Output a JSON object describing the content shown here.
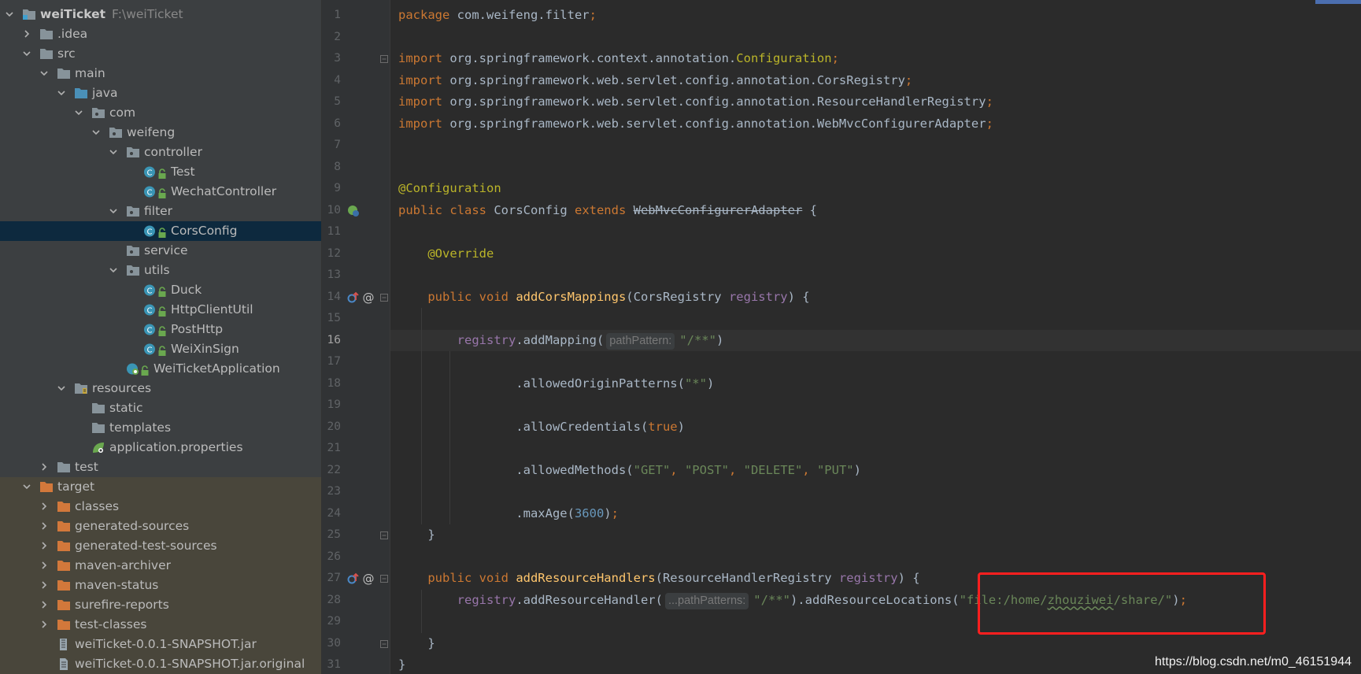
{
  "project": {
    "name": "weiTicket",
    "path": "F:\\weiTicket",
    "tree": [
      {
        "label": "weiTicket",
        "depth": 0,
        "chevron": "down",
        "icon": "module-icon",
        "bold": true,
        "hint": "F:\\weiTicket"
      },
      {
        "label": ".idea",
        "depth": 1,
        "chevron": "right",
        "icon": "folder-icon"
      },
      {
        "label": "src",
        "depth": 1,
        "chevron": "down",
        "icon": "folder-icon"
      },
      {
        "label": "main",
        "depth": 2,
        "chevron": "down",
        "icon": "folder-icon"
      },
      {
        "label": "java",
        "depth": 3,
        "chevron": "down",
        "icon": "source-folder-icon"
      },
      {
        "label": "com",
        "depth": 4,
        "chevron": "down",
        "icon": "package-icon"
      },
      {
        "label": "weifeng",
        "depth": 5,
        "chevron": "down",
        "icon": "package-icon"
      },
      {
        "label": "controller",
        "depth": 6,
        "chevron": "down",
        "icon": "package-icon"
      },
      {
        "label": "Test",
        "depth": 7,
        "chevron": "none",
        "icon": "class-icon"
      },
      {
        "label": "WechatController",
        "depth": 7,
        "chevron": "none",
        "icon": "class-icon"
      },
      {
        "label": "filter",
        "depth": 6,
        "chevron": "down",
        "icon": "package-icon"
      },
      {
        "label": "CorsConfig",
        "depth": 7,
        "chevron": "none",
        "icon": "class-icon",
        "selected": true
      },
      {
        "label": "service",
        "depth": 6,
        "chevron": "none",
        "icon": "package-icon"
      },
      {
        "label": "utils",
        "depth": 6,
        "chevron": "down",
        "icon": "package-icon"
      },
      {
        "label": "Duck",
        "depth": 7,
        "chevron": "none",
        "icon": "class-icon"
      },
      {
        "label": "HttpClientUtil",
        "depth": 7,
        "chevron": "none",
        "icon": "class-icon"
      },
      {
        "label": "PostHttp",
        "depth": 7,
        "chevron": "none",
        "icon": "class-icon"
      },
      {
        "label": "WeiXinSign",
        "depth": 7,
        "chevron": "none",
        "icon": "class-icon"
      },
      {
        "label": "WeiTicketApplication",
        "depth": 6,
        "chevron": "none",
        "icon": "spring-app-icon"
      },
      {
        "label": "resources",
        "depth": 3,
        "chevron": "down",
        "icon": "resources-folder-icon"
      },
      {
        "label": "static",
        "depth": 4,
        "chevron": "none",
        "icon": "folder-icon"
      },
      {
        "label": "templates",
        "depth": 4,
        "chevron": "none",
        "icon": "folder-icon"
      },
      {
        "label": "application.properties",
        "depth": 4,
        "chevron": "none",
        "icon": "spring-properties-icon"
      },
      {
        "label": "test",
        "depth": 2,
        "chevron": "right",
        "icon": "folder-icon"
      },
      {
        "label": "target",
        "depth": 1,
        "chevron": "down",
        "icon": "excluded-folder-icon",
        "excluded": true
      },
      {
        "label": "classes",
        "depth": 2,
        "chevron": "right",
        "icon": "excluded-folder-icon",
        "excluded": true
      },
      {
        "label": "generated-sources",
        "depth": 2,
        "chevron": "right",
        "icon": "excluded-folder-icon",
        "excluded": true
      },
      {
        "label": "generated-test-sources",
        "depth": 2,
        "chevron": "right",
        "icon": "excluded-folder-icon",
        "excluded": true
      },
      {
        "label": "maven-archiver",
        "depth": 2,
        "chevron": "right",
        "icon": "excluded-folder-icon",
        "excluded": true
      },
      {
        "label": "maven-status",
        "depth": 2,
        "chevron": "right",
        "icon": "excluded-folder-icon",
        "excluded": true
      },
      {
        "label": "surefire-reports",
        "depth": 2,
        "chevron": "right",
        "icon": "excluded-folder-icon",
        "excluded": true
      },
      {
        "label": "test-classes",
        "depth": 2,
        "chevron": "right",
        "icon": "excluded-folder-icon",
        "excluded": true
      },
      {
        "label": "weiTicket-0.0.1-SNAPSHOT.jar",
        "depth": 2,
        "chevron": "none",
        "icon": "jar-icon",
        "excluded": true
      },
      {
        "label": "weiTicket-0.0.1-SNAPSHOT.jar.original",
        "depth": 2,
        "chevron": "none",
        "icon": "file-icon",
        "excluded": true
      }
    ]
  },
  "editor": {
    "current_line": 16,
    "lines": [
      [
        [
          "k",
          "package "
        ],
        [
          "",
          "com.weifeng.filter"
        ],
        [
          "k",
          ";"
        ]
      ],
      [],
      [
        [
          "k",
          "import "
        ],
        [
          "",
          "org.springframework.context.annotation."
        ],
        [
          "a",
          "Configuration"
        ],
        [
          "k",
          ";"
        ]
      ],
      [
        [
          "k",
          "import "
        ],
        [
          "",
          "org.springframework.web.servlet.config.annotation.CorsRegistry"
        ],
        [
          "k",
          ";"
        ]
      ],
      [
        [
          "k",
          "import "
        ],
        [
          "",
          "org.springframework.web.servlet.config.annotation.ResourceHandlerRegistry"
        ],
        [
          "k",
          ";"
        ]
      ],
      [
        [
          "k",
          "import "
        ],
        [
          "",
          "org.springframework.web.servlet.config.annotation.WebMvcConfigurerAdapter"
        ],
        [
          "k",
          ";"
        ]
      ],
      [],
      [],
      [
        [
          "a",
          "@Configuration"
        ]
      ],
      [
        [
          "k",
          "public class "
        ],
        [
          "",
          "CorsConfig "
        ],
        [
          "k",
          "extends "
        ],
        [
          "st",
          "WebMvcConfigurerAdapter"
        ],
        [
          "",
          " {"
        ]
      ],
      [],
      [
        [
          "a",
          "    @Override"
        ]
      ],
      [],
      [
        [
          "k",
          "    public void "
        ],
        [
          "f",
          "addCorsMappings"
        ],
        [
          "",
          "(CorsRegistry "
        ],
        [
          "p",
          "registry"
        ],
        [
          "",
          ") {"
        ]
      ],
      [],
      [
        [
          "p",
          "        registry"
        ],
        [
          "",
          ".addMapping("
        ],
        [
          "hint",
          "pathPattern:"
        ],
        [
          "s",
          "\"/**\""
        ],
        [
          "",
          ")"
        ]
      ],
      [],
      [
        [
          "",
          "                .allowedOriginPatterns("
        ],
        [
          "s",
          "\"*\""
        ],
        [
          "",
          ")"
        ]
      ],
      [],
      [
        [
          "",
          "                .allowCredentials("
        ],
        [
          "k",
          "true"
        ],
        [
          "",
          ")"
        ]
      ],
      [],
      [
        [
          "",
          "                .allowedMethods("
        ],
        [
          "s",
          "\"GET\""
        ],
        [
          "k",
          ", "
        ],
        [
          "s",
          "\"POST\""
        ],
        [
          "k",
          ", "
        ],
        [
          "s",
          "\"DELETE\""
        ],
        [
          "k",
          ", "
        ],
        [
          "s",
          "\"PUT\""
        ],
        [
          "",
          ")"
        ]
      ],
      [],
      [
        [
          "",
          "                .maxAge("
        ],
        [
          "n",
          "3600"
        ],
        [
          "",
          ")"
        ],
        [
          "k",
          ";"
        ]
      ],
      [
        [
          "",
          "    }"
        ]
      ],
      [],
      [
        [
          "k",
          "    public void "
        ],
        [
          "f",
          "addResourceHandlers"
        ],
        [
          "",
          "(ResourceHandlerRegistry "
        ],
        [
          "p",
          "registry"
        ],
        [
          "",
          ") {"
        ]
      ],
      [
        [
          "p",
          "        registry"
        ],
        [
          "",
          ".addResourceHandler("
        ],
        [
          "hint",
          "...pathPatterns:"
        ],
        [
          "s",
          "\"/**\""
        ],
        [
          "",
          ").addResourceLocations("
        ],
        [
          "s",
          "\"file:/home/"
        ],
        [
          "sw",
          "zhouziwei"
        ],
        [
          "s",
          "/share/\""
        ],
        [
          "",
          ")"
        ],
        [
          "k",
          ";"
        ]
      ],
      [],
      [
        [
          "",
          "    }"
        ]
      ],
      [
        [
          "",
          "}"
        ]
      ]
    ]
  },
  "watermark": "https://blog.csdn.net/m0_46151944",
  "colors": {
    "keyword": "#cc7832",
    "annotation": "#bbb529",
    "string": "#6a8759",
    "number": "#6897bb",
    "method": "#ffc66d",
    "parameter": "#9876aa",
    "highlight_box": "#ff1f1f"
  }
}
